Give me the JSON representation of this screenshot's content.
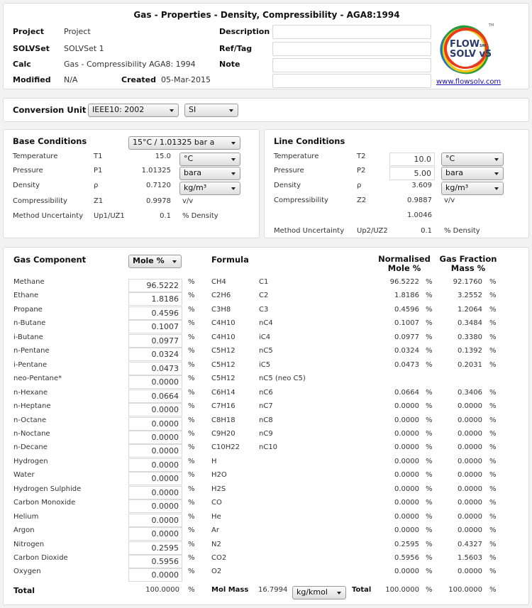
{
  "header": {
    "title": "Gas - Properties - Density, Compressibility - AGA8:1994",
    "project_label": "Project",
    "project_value": "Project",
    "solvset_label": "SOLVSet",
    "solvset_value": "SOLVSet 1",
    "calc_label": "Calc",
    "calc_value": "Gas - Compressibility AGA8: 1994",
    "modified_label": "Modified",
    "modified_value": "N/A",
    "created_label": "Created",
    "created_value": "05-Mar-2015",
    "description_label": "Description",
    "description_value": "",
    "reftag_label": "Ref/Tag",
    "reftag_value": "",
    "note_label": "Note",
    "note_value": "",
    "extra_value": "",
    "logo_line1": "FLOW",
    "logo_sm": "SM",
    "logo_line2": "SOLV v5",
    "logo_tm": "TM",
    "logo_link": "www.flowsolv.com",
    "logo_colors": [
      "#e63b1f",
      "#f5c518",
      "#2a9d3a",
      "#1f6fd1"
    ]
  },
  "conversion": {
    "label": "Conversion Unit",
    "standard": "IEEE10: 2002",
    "system": "SI"
  },
  "base": {
    "title": "Base Conditions",
    "preset": "15°C / 1.01325 bar a",
    "rows": [
      {
        "label": "Temperature",
        "symbol": "T1",
        "value": "15.0",
        "unit": "°C"
      },
      {
        "label": "Pressure",
        "symbol": "P1",
        "value": "1.01325",
        "unit": "bara"
      },
      {
        "label": "Density",
        "symbol": "ρ",
        "value": "0.7120",
        "unit": "kg/m³"
      },
      {
        "label": "Compressibility",
        "symbol": "Z1",
        "value": "0.9978",
        "unit": "v/v"
      },
      {
        "label": "Method Uncertainty",
        "symbol": "Up1/UZ1",
        "value": "0.1",
        "unit": "% Density"
      }
    ]
  },
  "line": {
    "title": "Line Conditions",
    "rows": [
      {
        "label": "Temperature",
        "symbol": "T2",
        "value": "10.0",
        "unit": "°C"
      },
      {
        "label": "Pressure",
        "symbol": "P2",
        "value": "5.00",
        "unit": "bara"
      },
      {
        "label": "Density",
        "symbol": "ρ",
        "value": "3.609",
        "unit": "kg/m³"
      },
      {
        "label": "Compressibility",
        "symbol": "Z2",
        "value": "0.9887",
        "unit": "v/v"
      },
      {
        "label": "",
        "symbol": "",
        "value": "1.0046",
        "unit": ""
      },
      {
        "label": "Method Uncertainty",
        "symbol": "Up2/UZ2",
        "value": "0.1",
        "unit": "% Density"
      }
    ]
  },
  "gas": {
    "title": "Gas Component",
    "basis": "Mole %",
    "formula_header": "Formula",
    "norm_header_1": "Normalised",
    "norm_header_2": "Mole %",
    "mass_header_1": "Gas Fraction",
    "mass_header_2": "Mass %",
    "pct": "%",
    "components": [
      {
        "name": "Methane",
        "input": "96.5222",
        "formula": "CH4",
        "code": "C1",
        "norm": "96.5222",
        "mass": "92.1760"
      },
      {
        "name": "Ethane",
        "input": "1.8186",
        "formula": "C2H6",
        "code": "C2",
        "norm": "1.8186",
        "mass": "3.2552"
      },
      {
        "name": "Propane",
        "input": "0.4596",
        "formula": "C3H8",
        "code": "C3",
        "norm": "0.4596",
        "mass": "1.2064"
      },
      {
        "name": "n-Butane",
        "input": "0.1007",
        "formula": "C4H10",
        "code": "nC4",
        "norm": "0.1007",
        "mass": "0.3484"
      },
      {
        "name": "i-Butane",
        "input": "0.0977",
        "formula": "C4H10",
        "code": "iC4",
        "norm": "0.0977",
        "mass": "0.3380"
      },
      {
        "name": "n-Pentane",
        "input": "0.0324",
        "formula": "C5H12",
        "code": "nC5",
        "norm": "0.0324",
        "mass": "0.1392"
      },
      {
        "name": "i-Pentane",
        "input": "0.0473",
        "formula": "C5H12",
        "code": "iC5",
        "norm": "0.0473",
        "mass": "0.2031"
      },
      {
        "name": "neo-Pentane*",
        "input": "0.0000",
        "formula": "C5H12",
        "code": "nC5 (neo C5)",
        "norm": "",
        "mass": ""
      },
      {
        "name": "n-Hexane",
        "input": "0.0664",
        "formula": "C6H14",
        "code": "nC6",
        "norm": "0.0664",
        "mass": "0.3406"
      },
      {
        "name": "n-Heptane",
        "input": "0.0000",
        "formula": "C7H16",
        "code": "nC7",
        "norm": "0.0000",
        "mass": "0.0000"
      },
      {
        "name": "n-Octane",
        "input": "0.0000",
        "formula": "C8H18",
        "code": "nC8",
        "norm": "0.0000",
        "mass": "0.0000"
      },
      {
        "name": "n-Noctane",
        "input": "0.0000",
        "formula": "C9H20",
        "code": "nC9",
        "norm": "0.0000",
        "mass": "0.0000"
      },
      {
        "name": "n-Decane",
        "input": "0.0000",
        "formula": "C10H22",
        "code": "nC10",
        "norm": "0.0000",
        "mass": "0.0000"
      },
      {
        "name": "Hydrogen",
        "input": "0.0000",
        "formula": "H",
        "code": "",
        "norm": "0.0000",
        "mass": "0.0000"
      },
      {
        "name": "Water",
        "input": "0.0000",
        "formula": "H2O",
        "code": "",
        "norm": "0.0000",
        "mass": "0.0000"
      },
      {
        "name": "Hydrogen Sulphide",
        "input": "0.0000",
        "formula": "H2S",
        "code": "",
        "norm": "0.0000",
        "mass": "0.0000"
      },
      {
        "name": "Carbon Monoxide",
        "input": "0.0000",
        "formula": "CO",
        "code": "",
        "norm": "0.0000",
        "mass": "0.0000"
      },
      {
        "name": "Helium",
        "input": "0.0000",
        "formula": "He",
        "code": "",
        "norm": "0.0000",
        "mass": "0.0000"
      },
      {
        "name": "Argon",
        "input": "0.0000",
        "formula": "Ar",
        "code": "",
        "norm": "0.0000",
        "mass": "0.0000"
      },
      {
        "name": "Nitrogen",
        "input": "0.2595",
        "formula": "N2",
        "code": "",
        "norm": "0.2595",
        "mass": "0.4327"
      },
      {
        "name": "Carbon Dioxide",
        "input": "0.5956",
        "formula": "CO2",
        "code": "",
        "norm": "0.5956",
        "mass": "1.5603"
      },
      {
        "name": "Oxygen",
        "input": "0.0000",
        "formula": "O2",
        "code": "",
        "norm": "0.0000",
        "mass": "0.0000"
      }
    ],
    "total_label": "Total",
    "total_input": "100.0000",
    "molmass_label": "Mol Mass",
    "molmass_value": "16.7994",
    "molmass_unit": "kg/kmol",
    "total_label_2": "Total",
    "total_norm": "100.0000",
    "total_mass": "100.0000"
  }
}
